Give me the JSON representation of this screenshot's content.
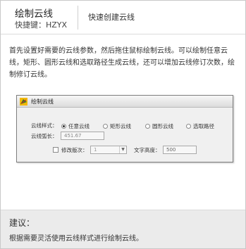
{
  "header": {
    "title": "绘制云线",
    "shortcut": "快捷键：HZYX",
    "description": "快速创建云线"
  },
  "intro": "首先设置好需要的云线参数，然后拖住鼠标绘制云线。可以绘制任意云线，矩形、圆形云线和选取路径生成云线，还可以增加云线修订次数，绘制修订云线。",
  "dialog": {
    "title": "绘制云线",
    "style_label": "云线样式：",
    "style_options": [
      "任意云线",
      "矩形云线",
      "圆形云线",
      "选取路径"
    ],
    "selected_style": "任意云线",
    "arc_label": "云线弧长：",
    "arc_value": "451.67",
    "revision_label": "修改版次：",
    "revision_value": "1",
    "text_height_label": "文字高度：",
    "text_height_value": "500"
  },
  "footer": {
    "title": "建议：",
    "text": "根据需要灵活使用云线样式进行绘制云线。"
  }
}
